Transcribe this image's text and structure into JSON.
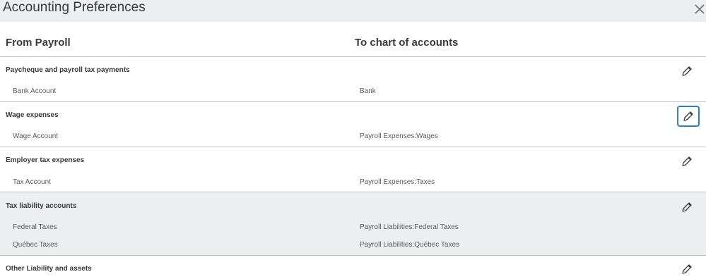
{
  "dialog": {
    "title": "Accounting Preferences"
  },
  "table": {
    "col_from": "From Payroll",
    "col_to": "To chart of accounts"
  },
  "sections": [
    {
      "title": "Paycheque and payroll tax payments",
      "rows": [
        {
          "label": "Bank Account",
          "value": "Bank"
        }
      ]
    },
    {
      "title": "Wage expenses",
      "rows": [
        {
          "label": "Wage Account",
          "value": "Payroll Expenses:Wages"
        }
      ]
    },
    {
      "title": "Employer tax expenses",
      "rows": [
        {
          "label": "Tax Account",
          "value": "Payroll Expenses:Taxes"
        }
      ]
    },
    {
      "title": "Tax liability accounts",
      "rows": [
        {
          "label": "Federal Taxes",
          "value": "Payroll Liabilities:Federal Taxes"
        },
        {
          "label": "Québec Taxes",
          "value": "Payroll Liabilities:Québec Taxes"
        }
      ]
    },
    {
      "title": "Other Liability and assets",
      "rows": []
    }
  ],
  "icons": {
    "close": "close-icon",
    "edit": "pencil-icon"
  },
  "colors": {
    "focus_ring": "#2d7fc0",
    "highlight_bg": "#eceef1"
  }
}
